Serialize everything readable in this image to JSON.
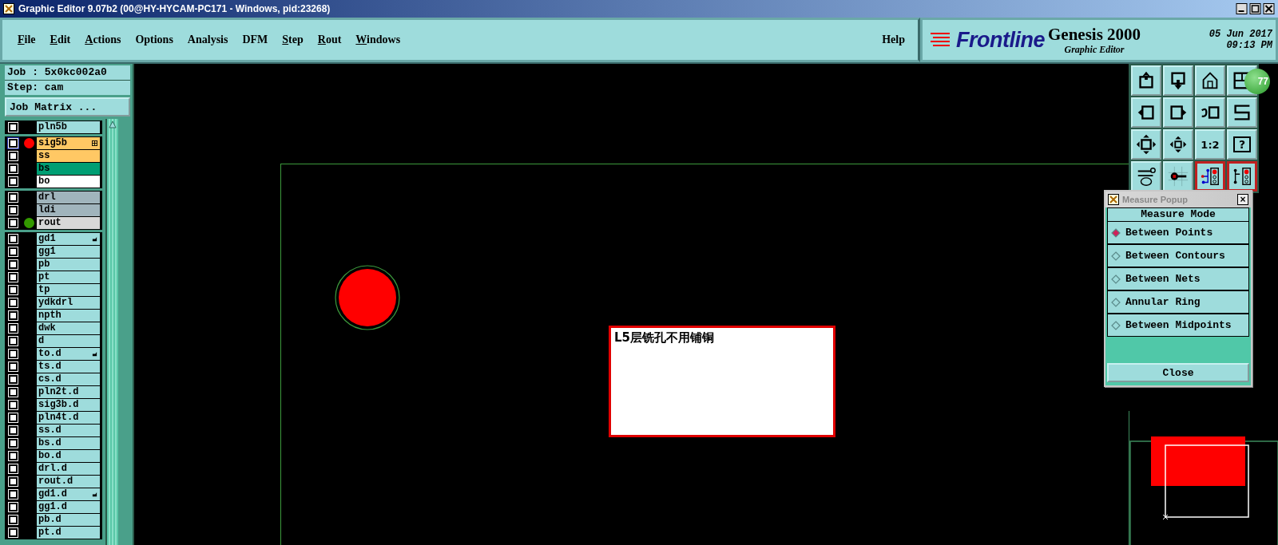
{
  "window": {
    "title": "Graphic Editor 9.07b2 (00@HY-HYCAM-PC171 - Windows, pid:23268)"
  },
  "menu": [
    {
      "label": "File",
      "underlined": true
    },
    {
      "label": "Edit",
      "underlined": true
    },
    {
      "label": "Actions",
      "underlined": true
    },
    {
      "label": "Options",
      "underlined": false
    },
    {
      "label": "Analysis",
      "underlined": false
    },
    {
      "label": "DFM",
      "underlined": false
    },
    {
      "label": "Step",
      "underlined": true
    },
    {
      "label": "Rout",
      "underlined": true
    },
    {
      "label": "Windows",
      "underlined": true
    }
  ],
  "help_menu": {
    "label": "Help"
  },
  "brand": {
    "logo": "Frontline",
    "product": "Genesis 2000",
    "subtitle": "Graphic Editor",
    "date": "05 Jun 2017",
    "time": "09:13 PM"
  },
  "job": {
    "job": "Job : 5x0kc002a0",
    "step": "Step: cam",
    "matrix_button": "Job Matrix ..."
  },
  "layer_groups": [
    [
      {
        "name": "pln5b",
        "color": "#9edcdc",
        "checked": false,
        "selected": false,
        "grid_mark": false,
        "pointer_mark": false
      }
    ],
    [
      {
        "name": "sig5b",
        "color": "#ffc864",
        "checked": false,
        "selected": true,
        "marker": {
          "color": "#ff0000"
        },
        "grid_mark": true,
        "pointer_mark": false
      },
      {
        "name": "ss",
        "color": "#ffc864",
        "checked": false,
        "selected": false,
        "grid_mark": false,
        "pointer_mark": false
      },
      {
        "name": "bs",
        "color": "#009e73",
        "checked": false,
        "selected": false,
        "grid_mark": false,
        "pointer_mark": false
      },
      {
        "name": "bo",
        "color": "#ffffff",
        "checked": false,
        "selected": false,
        "grid_mark": false,
        "pointer_mark": false
      }
    ],
    [
      {
        "name": "drl",
        "color": "#a0b4bc",
        "checked": false,
        "selected": false,
        "grid_mark": false,
        "pointer_mark": false
      },
      {
        "name": "ldi",
        "color": "#a0b4bc",
        "checked": false,
        "selected": false,
        "grid_mark": false,
        "pointer_mark": false
      },
      {
        "name": "rout",
        "color": "#d8d8d8",
        "checked": false,
        "selected": false,
        "marker": {
          "color": "#339900"
        },
        "grid_mark": false,
        "pointer_mark": false
      }
    ],
    [
      {
        "name": "gd1",
        "color": "#9edcdc",
        "checked": false,
        "selected": false,
        "grid_mark": false,
        "pointer_mark": true
      },
      {
        "name": "gg1",
        "color": "#9edcdc",
        "checked": false,
        "selected": false,
        "grid_mark": false,
        "pointer_mark": false
      },
      {
        "name": "pb",
        "color": "#9edcdc",
        "checked": false,
        "selected": false,
        "grid_mark": false,
        "pointer_mark": false
      },
      {
        "name": "pt",
        "color": "#9edcdc",
        "checked": false,
        "selected": false,
        "grid_mark": false,
        "pointer_mark": false
      },
      {
        "name": "tp",
        "color": "#9edcdc",
        "checked": false,
        "selected": false,
        "grid_mark": false,
        "pointer_mark": false
      },
      {
        "name": "ydkdrl",
        "color": "#9edcdc",
        "checked": false,
        "selected": false,
        "grid_mark": false,
        "pointer_mark": false
      },
      {
        "name": "npth",
        "color": "#9edcdc",
        "checked": false,
        "selected": false,
        "grid_mark": false,
        "pointer_mark": false
      },
      {
        "name": "dwk",
        "color": "#9edcdc",
        "checked": false,
        "selected": false,
        "grid_mark": false,
        "pointer_mark": false
      },
      {
        "name": "d",
        "color": "#9edcdc",
        "checked": false,
        "selected": false,
        "grid_mark": false,
        "pointer_mark": false
      },
      {
        "name": "to.d",
        "color": "#9edcdc",
        "checked": false,
        "selected": false,
        "grid_mark": false,
        "pointer_mark": true
      },
      {
        "name": "ts.d",
        "color": "#9edcdc",
        "checked": false,
        "selected": false,
        "grid_mark": false,
        "pointer_mark": false
      },
      {
        "name": "cs.d",
        "color": "#9edcdc",
        "checked": false,
        "selected": false,
        "grid_mark": false,
        "pointer_mark": false
      },
      {
        "name": "pln2t.d",
        "color": "#9edcdc",
        "checked": false,
        "selected": false,
        "grid_mark": false,
        "pointer_mark": false
      },
      {
        "name": "sig3b.d",
        "color": "#9edcdc",
        "checked": false,
        "selected": false,
        "grid_mark": false,
        "pointer_mark": false
      },
      {
        "name": "pln4t.d",
        "color": "#9edcdc",
        "checked": false,
        "selected": false,
        "grid_mark": false,
        "pointer_mark": false
      },
      {
        "name": "ss.d",
        "color": "#9edcdc",
        "checked": false,
        "selected": false,
        "grid_mark": false,
        "pointer_mark": false
      },
      {
        "name": "bs.d",
        "color": "#9edcdc",
        "checked": false,
        "selected": false,
        "grid_mark": false,
        "pointer_mark": false
      },
      {
        "name": "bo.d",
        "color": "#9edcdc",
        "checked": false,
        "selected": false,
        "grid_mark": false,
        "pointer_mark": false
      },
      {
        "name": "drl.d",
        "color": "#9edcdc",
        "checked": false,
        "selected": false,
        "grid_mark": false,
        "pointer_mark": false
      },
      {
        "name": "rout.d",
        "color": "#9edcdc",
        "checked": false,
        "selected": false,
        "grid_mark": false,
        "pointer_mark": false
      },
      {
        "name": "gd1.d",
        "color": "#9edcdc",
        "checked": false,
        "selected": false,
        "grid_mark": false,
        "pointer_mark": true
      },
      {
        "name": "gg1.d",
        "color": "#9edcdc",
        "checked": false,
        "selected": false,
        "grid_mark": false,
        "pointer_mark": false
      },
      {
        "name": "pb.d",
        "color": "#9edcdc",
        "checked": false,
        "selected": false,
        "grid_mark": false,
        "pointer_mark": false
      },
      {
        "name": "pt.d",
        "color": "#9edcdc",
        "checked": false,
        "selected": false,
        "grid_mark": false,
        "pointer_mark": false
      }
    ]
  ],
  "canvas": {
    "note": "L5层铣孔不用铺铜"
  },
  "toolbox": {
    "ratio_label": "1:2",
    "help_label": "?",
    "badge": "77"
  },
  "measure_popup": {
    "title": "Measure Popup",
    "close_glyph": "×",
    "heading": "Measure Mode",
    "options": [
      {
        "label": "Between Points",
        "selected": true
      },
      {
        "label": "Between Contours",
        "selected": false
      },
      {
        "label": "Between Nets",
        "selected": false
      },
      {
        "label": "Annular Ring",
        "selected": false
      },
      {
        "label": "Between Midpoints",
        "selected": false
      }
    ],
    "close_button": "Close"
  }
}
